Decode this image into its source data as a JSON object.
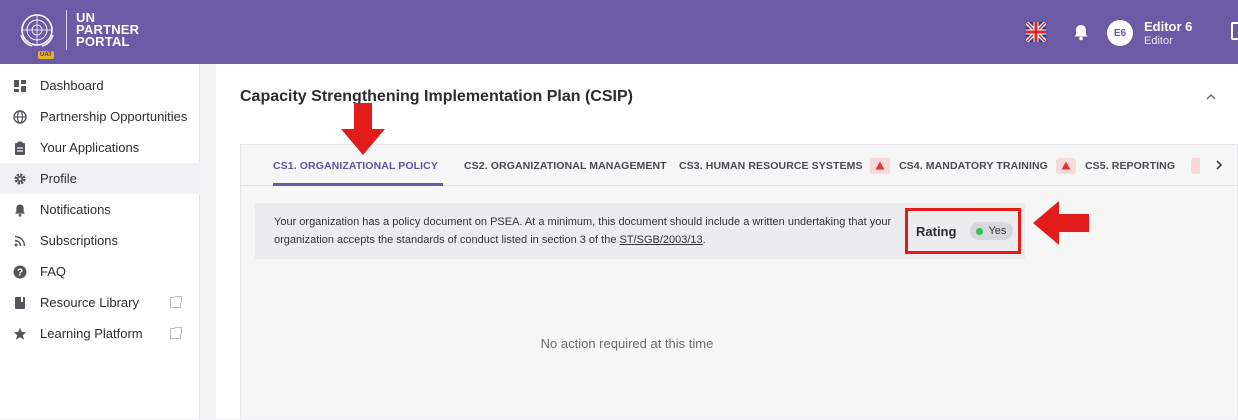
{
  "header": {
    "logo_lines": [
      "UN",
      "PARTNER",
      "PORTAL"
    ],
    "env_badge": "UAT",
    "language_icon": "uk-flag-icon",
    "notifications_icon": "bell-icon",
    "user": {
      "initials": "E6",
      "name": "Editor 6",
      "role": "Editor"
    },
    "brand_color": "#6c5aa6"
  },
  "sidebar": {
    "items": [
      {
        "label": "Dashboard",
        "icon": "dashboard-icon",
        "active": false,
        "external": false
      },
      {
        "label": "Partnership Opportunities",
        "icon": "globe-icon",
        "active": false,
        "external": false
      },
      {
        "label": "Your Applications",
        "icon": "clipboard-icon",
        "active": false,
        "external": false
      },
      {
        "label": "Profile",
        "icon": "gear-icon",
        "active": true,
        "external": false
      },
      {
        "label": "Notifications",
        "icon": "bell-icon",
        "active": false,
        "external": false
      },
      {
        "label": "Subscriptions",
        "icon": "rss-icon",
        "active": false,
        "external": false
      },
      {
        "label": "FAQ",
        "icon": "help-icon",
        "active": false,
        "external": false
      },
      {
        "label": "Resource Library",
        "icon": "book-icon",
        "active": false,
        "external": true
      },
      {
        "label": "Learning Platform",
        "icon": "star-icon",
        "active": false,
        "external": true
      }
    ]
  },
  "main": {
    "title": "Capacity Strengthening Implementation Plan (CSIP)",
    "tabs": [
      {
        "label": "CS1. ORGANIZATIONAL POLICY",
        "active": true,
        "warning": false
      },
      {
        "label": "CS2. ORGANIZATIONAL MANAGEMENT",
        "active": false,
        "warning": false
      },
      {
        "label": "CS3. HUMAN RESOURCE SYSTEMS",
        "active": false,
        "warning": false
      },
      {
        "label": "CS4. MANDATORY TRAINING",
        "active": false,
        "warning": true
      },
      {
        "label": "CS5. REPORTING",
        "active": false,
        "warning": true
      }
    ],
    "requirement": {
      "text_before_link": "Your organization has a policy document on PSEA. At a minimum, this document should include a written undertaking that your organization accepts the standards of conduct listed in section 3 of the ",
      "link": "ST/SGB/2003/13",
      "text_after_link": "."
    },
    "rating": {
      "label": "Rating",
      "value": "Yes",
      "status_color": "#3cbd55"
    },
    "empty_message": "No action required at this time",
    "annotation_color": "#e31b1b"
  }
}
